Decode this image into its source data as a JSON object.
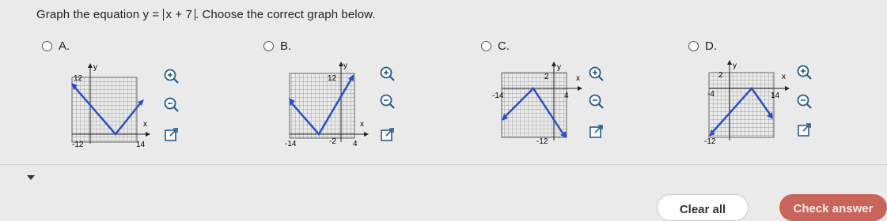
{
  "question": {
    "prefix": "Graph the equation",
    "equation_lhs": "y = ",
    "equation_abs": "x + 7",
    "suffix": ". Choose the correct graph below."
  },
  "options": [
    {
      "letter": "A.",
      "labels": {
        "y_top": "12",
        "x_left": "-12",
        "x_right": "14",
        "x_axis": "x",
        "y_axis": "y"
      }
    },
    {
      "letter": "B.",
      "labels": {
        "y_top": "12",
        "x_left": "-14",
        "x_right": "4",
        "x_mid": "-2",
        "x_axis": "x",
        "y_axis": "y"
      }
    },
    {
      "letter": "C.",
      "labels": {
        "y_top": "2",
        "x_left": "-14",
        "x_right": "4",
        "y_bottom": "-12",
        "x_axis": "x",
        "y_axis": "y"
      }
    },
    {
      "letter": "D.",
      "labels": {
        "y_top": "2",
        "x_left": "-4",
        "x_right": "14",
        "y_bottom": "-12",
        "x_axis": "x",
        "y_axis": "y"
      }
    }
  ],
  "icons": {
    "zoom_in": "zoom-in-icon",
    "zoom_out": "zoom-out-icon",
    "popout": "external-link-icon"
  },
  "buttons": {
    "clear": "Clear all",
    "check": "Check answer"
  },
  "colors": {
    "graph_line": "#2b50c8",
    "accent_button": "#c8645a"
  }
}
